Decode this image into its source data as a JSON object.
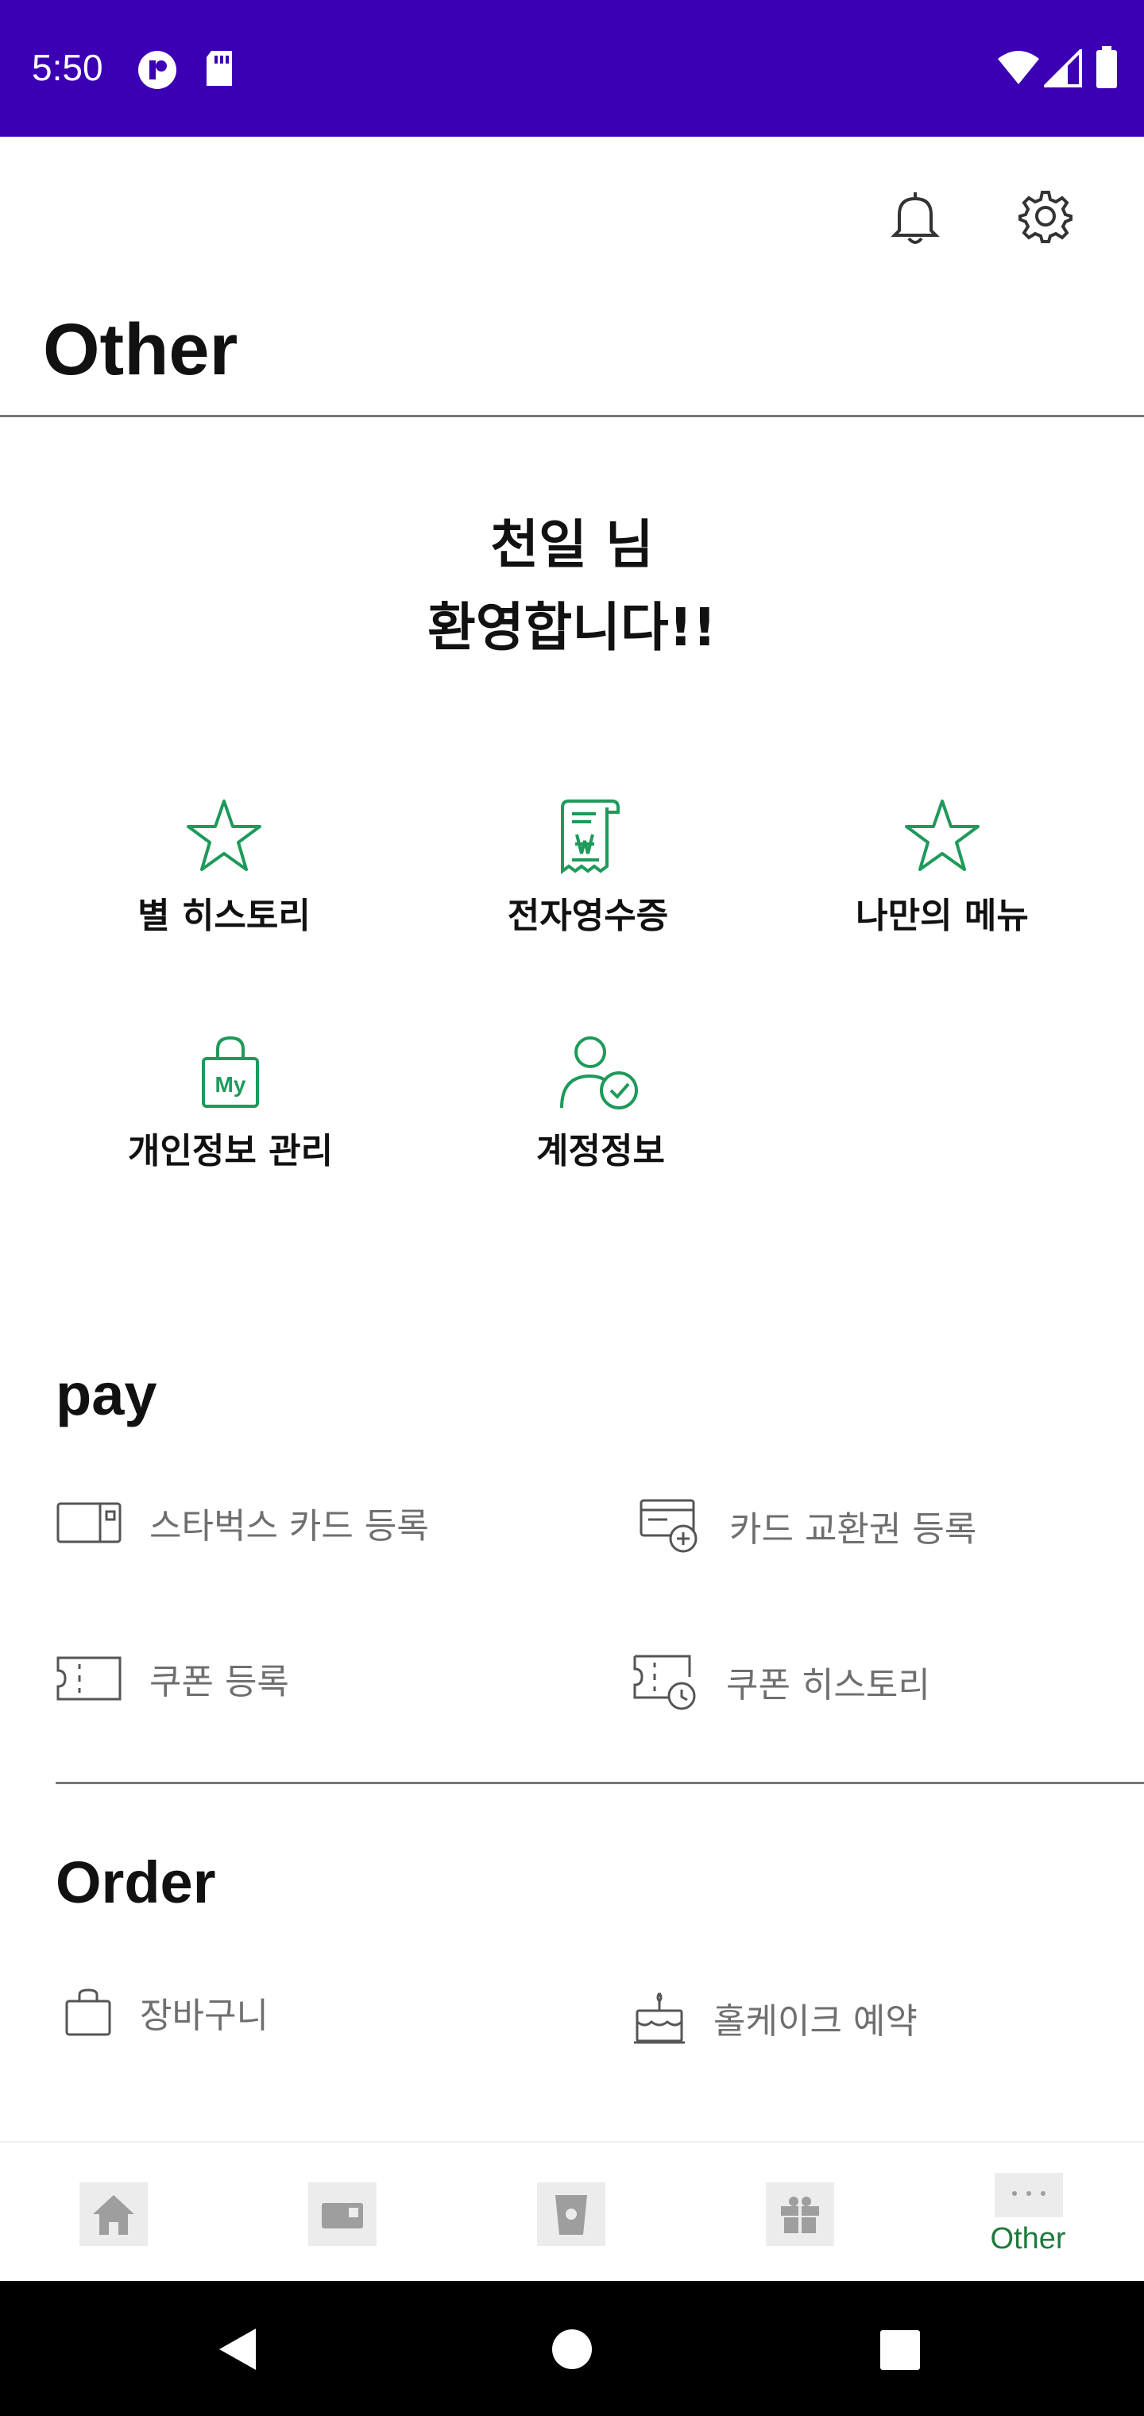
{
  "status_bar": {
    "time": "5:50",
    "background": "#3c00b4"
  },
  "header": {
    "title": "Other",
    "icons": [
      "bell-icon",
      "gear-icon"
    ]
  },
  "greeting": {
    "line1": "천일 님",
    "line2": "환영합니다!!"
  },
  "quick_menu": [
    {
      "label": "별 히스토리",
      "icon": "star-icon"
    },
    {
      "label": "전자영수증",
      "icon": "receipt-icon"
    },
    {
      "label": "나만의 메뉴",
      "icon": "star-icon"
    },
    {
      "label": "개인정보 관리",
      "icon": "lock-my-icon",
      "icon_text": "My"
    },
    {
      "label": "계정정보",
      "icon": "account-check-icon"
    }
  ],
  "pay": {
    "title": "pay",
    "items": [
      {
        "label": "스타벅스 카드 등록",
        "icon": "card-icon"
      },
      {
        "label": "카드 교환권 등록",
        "icon": "card-add-icon"
      },
      {
        "label": "쿠폰 등록",
        "icon": "coupon-icon"
      },
      {
        "label": "쿠폰 히스토리",
        "icon": "coupon-history-icon"
      }
    ]
  },
  "order": {
    "title": "Order",
    "items": [
      {
        "label": "장바구니",
        "icon": "shopping-bag-icon"
      },
      {
        "label": "홀케이크 예약",
        "icon": "cake-icon"
      }
    ]
  },
  "bottom_nav": {
    "items": [
      {
        "icon": "home-icon"
      },
      {
        "icon": "wallet-card-icon"
      },
      {
        "icon": "cup-icon"
      },
      {
        "icon": "gift-icon"
      },
      {
        "icon": "more-dots-icon",
        "label": "Other",
        "active": true
      }
    ],
    "active_color": "#1e7b3c"
  },
  "colors": {
    "accent_green": "#1e9a5a",
    "muted_text": "#6f6f6f"
  }
}
